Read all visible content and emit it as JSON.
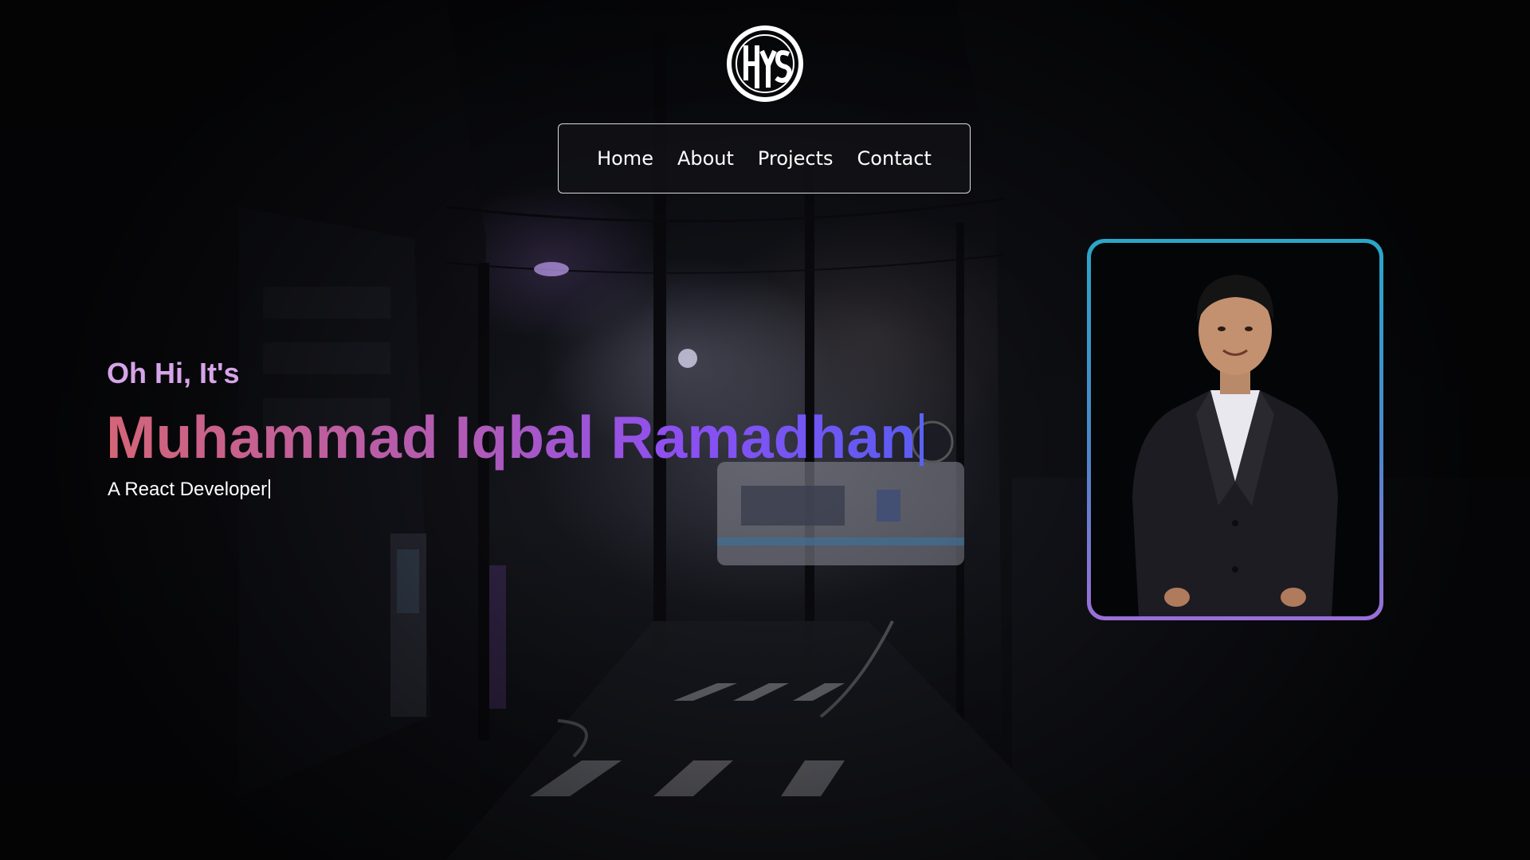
{
  "logo": {
    "icon": "hys-monogram-logo"
  },
  "nav": {
    "items": [
      {
        "label": "Home"
      },
      {
        "label": "About"
      },
      {
        "label": "Projects"
      },
      {
        "label": "Contact"
      }
    ]
  },
  "hero": {
    "greeting": "Oh Hi, It's",
    "name": "Muhammad Iqbal Ramadhan",
    "role": "A React Developer",
    "name_gradient": [
      "#d46577",
      "#b05ab7",
      "#8d4ff2",
      "#5a5cf2"
    ],
    "greeting_color": "#d6a4e8"
  },
  "profile": {
    "image": "portrait-photo",
    "border_gradient": [
      "#2aa6c8",
      "#4a86c8",
      "#9a6fd8"
    ]
  }
}
